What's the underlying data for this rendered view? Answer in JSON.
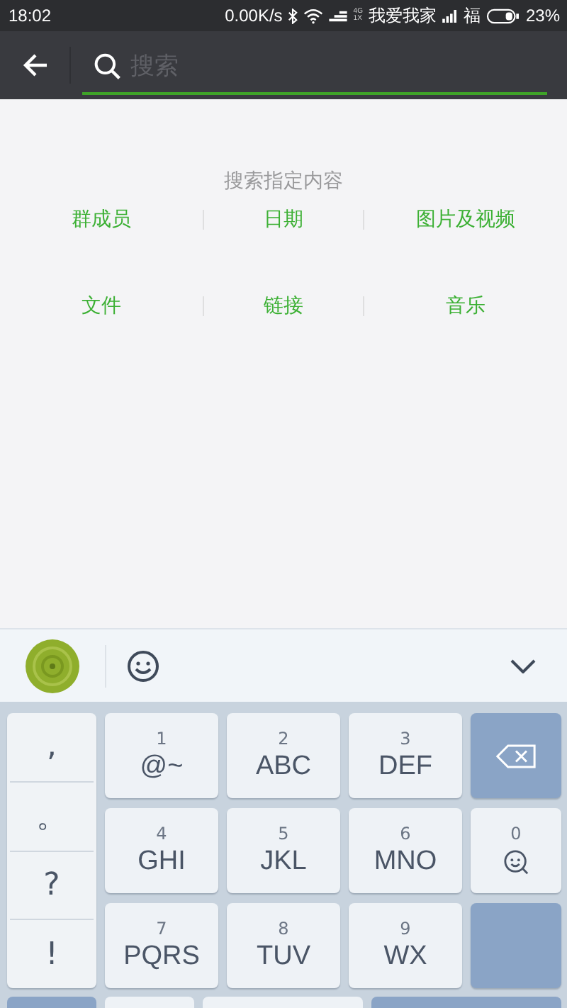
{
  "status_bar": {
    "time": "18:02",
    "speed": "0.00K/s",
    "network_type": [
      "4G",
      "1X"
    ],
    "carrier": "我爱我家",
    "sim2": "福",
    "battery": "23%"
  },
  "search": {
    "placeholder": "搜索"
  },
  "hint": "搜索指定内容",
  "categories": [
    "群成员",
    "日期",
    "图片及视频",
    "文件",
    "链接",
    "音乐"
  ],
  "keyboard": {
    "symbols": [
      ",",
      "。",
      "?",
      "!"
    ],
    "keys": [
      {
        "kind": "t9",
        "number": "1",
        "letters": "@~"
      },
      {
        "kind": "t9",
        "number": "2",
        "letters": "ABC"
      },
      {
        "kind": "t9",
        "number": "3",
        "letters": "DEF"
      },
      {
        "kind": "delete"
      },
      {
        "kind": "t9",
        "number": "4",
        "letters": "GHI"
      },
      {
        "kind": "t9",
        "number": "5",
        "letters": "JKL"
      },
      {
        "kind": "t9",
        "number": "6",
        "letters": "MNO"
      },
      {
        "kind": "face",
        "number": "0"
      },
      {
        "kind": "t9",
        "number": "7",
        "letters": "PQRS"
      },
      {
        "kind": "t9",
        "number": "8",
        "letters": "TUV"
      },
      {
        "kind": "t9",
        "number": "9",
        "letters": "WX"
      },
      {
        "kind": "blank"
      }
    ]
  }
}
